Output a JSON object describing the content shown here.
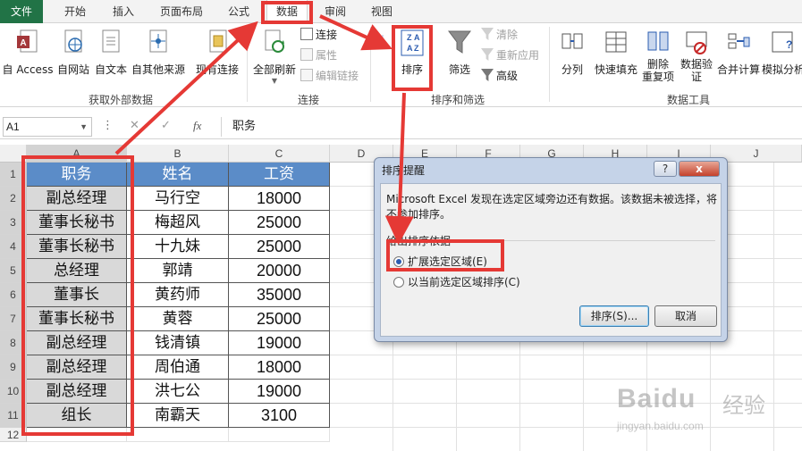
{
  "tabs": [
    {
      "label": "文件"
    },
    {
      "label": "开始"
    },
    {
      "label": "插入"
    },
    {
      "label": "页面布局"
    },
    {
      "label": "公式"
    },
    {
      "label": "数据"
    },
    {
      "label": "审阅"
    },
    {
      "label": "视图"
    }
  ],
  "ribbon": {
    "external": {
      "access": "自 Access",
      "web": "自网站",
      "text": "自文本",
      "other": "自其他来源",
      "existing": "现有连接",
      "group": "获取外部数据"
    },
    "connections": {
      "refresh_all": "全部刷新",
      "connections": "连接",
      "properties": "属性",
      "edit_links": "编辑链接",
      "group": "连接"
    },
    "sort_filter": {
      "sort_az": "A↓Z",
      "sort": "排序",
      "filter": "筛选",
      "clear": "清除",
      "reapply": "重新应用",
      "advanced": "高级",
      "group": "排序和筛选"
    },
    "tools": {
      "text_to_columns": "分列",
      "flash_fill": "快速填充",
      "remove_duplicates": "删除\n重复项",
      "validation": "数据验\n证",
      "consolidate": "合并计算",
      "what_if": "模拟分析",
      "group": "数据工具"
    }
  },
  "formula_bar": {
    "name_box": "A1",
    "fx": "fx",
    "content": "职务"
  },
  "columns": [
    "A",
    "B",
    "C",
    "D",
    "E",
    "F",
    "G",
    "H",
    "I",
    "J"
  ],
  "rows": [
    "1",
    "2",
    "3",
    "4",
    "5",
    "6",
    "7",
    "8",
    "9",
    "10",
    "11",
    "12"
  ],
  "table": {
    "headers": [
      "职务",
      "姓名",
      "工资"
    ],
    "data": [
      [
        "副总经理",
        "马行空",
        "18000"
      ],
      [
        "董事长秘书",
        "梅超风",
        "25000"
      ],
      [
        "董事长秘书",
        "十九妹",
        "25000"
      ],
      [
        "总经理",
        "郭靖",
        "20000"
      ],
      [
        "董事长",
        "黄药师",
        "35000"
      ],
      [
        "董事长秘书",
        "黄蓉",
        "25000"
      ],
      [
        "副总经理",
        "钱清镇",
        "19000"
      ],
      [
        "副总经理",
        "周伯通",
        "18000"
      ],
      [
        "副总经理",
        "洪七公",
        "19000"
      ],
      [
        "组长",
        "南霸天",
        "3100"
      ]
    ]
  },
  "dialog": {
    "title": "排序提醒",
    "help": "?",
    "close": "x",
    "message": "Microsoft Excel 发现在选定区域旁边还有数据。该数据未被选择，将不参加排序。",
    "group_label": "给出排序依据",
    "option1": "扩展选定区域(E)",
    "option2": "以当前选定区域排序(C)",
    "sort_button": "排序(S)...",
    "cancel_button": "取消"
  },
  "watermark": {
    "brand": "Baidu",
    "brand_cn": "经验",
    "url": "jingyan.baidu.com"
  },
  "colors": {
    "excel_green": "#217346",
    "header_blue": "#5b8cc8",
    "annotation_red": "#e53935",
    "dialog_frame": "#c5d3e8"
  }
}
